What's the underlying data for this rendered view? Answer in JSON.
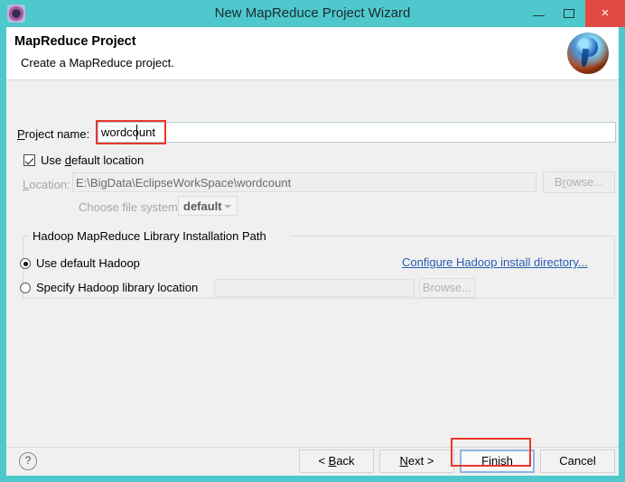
{
  "window": {
    "title": "New MapReduce Project Wizard",
    "app_icon": "eclipse-icon",
    "controls": {
      "minimize": "minimize-icon",
      "maximize": "maximize-icon",
      "close": "×"
    },
    "titlebar_color": "#4ec8cd",
    "close_color": "#e04a42"
  },
  "header": {
    "title": "MapReduce Project",
    "subtitle": "Create a MapReduce project.",
    "logo": "hadoop-elephant-logo"
  },
  "form": {
    "project_name_label": "Project name:",
    "project_name_value": "wordcount",
    "project_name_placeholder": "",
    "use_default_location_label": "Use default location",
    "use_default_location_checked": true,
    "location_label": "Location:",
    "location_value": "E:\\BigData\\EclipseWorkSpace\\wordcount",
    "location_browse_label": "Browse...",
    "filesystem_label": "Choose file system:",
    "filesystem_value": "default",
    "filesystem_options": [
      "default"
    ]
  },
  "hadoop_group": {
    "legend": "Hadoop MapReduce Library Installation Path",
    "option_default_label": "Use default Hadoop",
    "option_specify_label": "Specify Hadoop library location",
    "selected": "default",
    "configure_link": "Configure Hadoop install directory...",
    "configure_link_color": "#2a5db0",
    "library_path_value": "",
    "library_browse_label": "Browse..."
  },
  "footer": {
    "help_icon": "?",
    "back_label": "< Back",
    "next_label": "Next >",
    "finish_label": "Finish",
    "cancel_label": "Cancel",
    "focused_button": "Finish"
  },
  "annotations": {
    "highlight_color": "#e8372b",
    "highlighted_elements": [
      "project-name-value",
      "finish-button"
    ]
  }
}
